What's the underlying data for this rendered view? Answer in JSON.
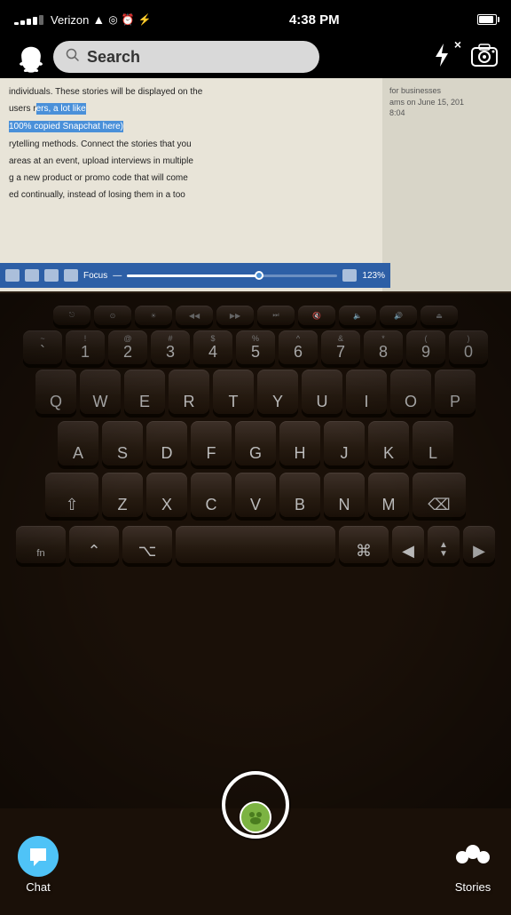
{
  "status": {
    "carrier": "Verizon",
    "time": "4:38 PM",
    "signal_dots": [
      2,
      3,
      4,
      5,
      6
    ],
    "battery_percent": 80
  },
  "search": {
    "placeholder": "Search",
    "text": "Search"
  },
  "document_text": {
    "line1": "individuals. These stories will be displayed on the",
    "line2": "users r",
    "line2_highlight": "ers, a lot like",
    "line3_highlight": "100% copied Snapchat here)",
    "line4": "rytelling methods. Connect the stories that you",
    "line5": "areas at an event, upload interviews in multiple",
    "line6": "g a new product or promo code that will come",
    "line7": "ed continually, instead of losing them in a too"
  },
  "right_doc": {
    "line1": "for businesses",
    "line2": "ams on June 15, 201",
    "line3": "8:04"
  },
  "toolbar": {
    "focus_label": "Focus",
    "zoom_label": "123%"
  },
  "bottom_nav": {
    "chat_label": "Chat",
    "stories_label": "Stories"
  },
  "icons": {
    "search": "🔍",
    "flash": "⚡",
    "camera_flip": "⟳",
    "chat_bubble": "💬",
    "stories": "●●●"
  },
  "keyboard_rows": {
    "fn_row": [
      {
        "label": "",
        "sub": ""
      },
      {
        "label": "≪",
        "sub": ""
      },
      {
        "label": "⊕",
        "sub": ""
      },
      {
        "label": "◁◁",
        "sub": ""
      },
      {
        "label": "▶▶",
        "sub": ""
      },
      {
        "label": "▷▷",
        "sub": ""
      }
    ],
    "number_row": [
      {
        "main": "5",
        "sub": "%"
      },
      {
        "main": "6",
        "sub": "^"
      },
      {
        "main": "7",
        "sub": "&"
      },
      {
        "main": "8",
        "sub": "*"
      },
      {
        "main": "9",
        "sub": "("
      },
      {
        "main": "0",
        "sub": ")"
      }
    ],
    "qwerty_top": [
      "T",
      "Y",
      "U",
      "I",
      "O"
    ],
    "qwerty_mid": [
      "G",
      "H",
      "J",
      "K"
    ],
    "qwerty_bot": [
      "B",
      "N",
      "M"
    ]
  }
}
